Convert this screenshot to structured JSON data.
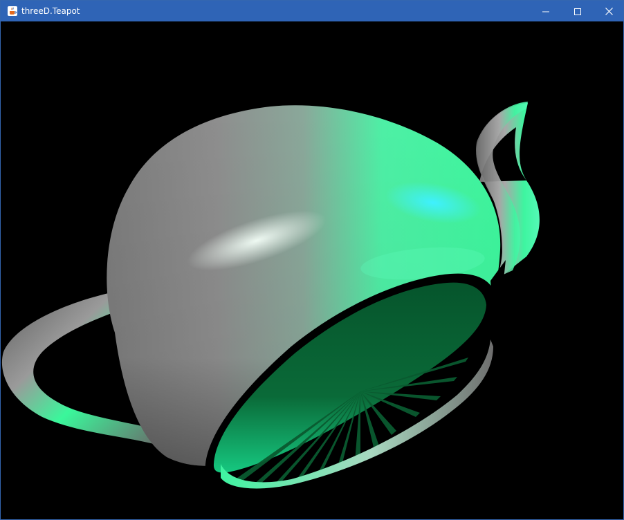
{
  "window": {
    "title": "threeD.Teapot",
    "controls": {
      "minimize_icon": "minimize-icon",
      "maximize_icon": "maximize-icon",
      "close_icon": "close-icon"
    },
    "app_icon": "java-cup-icon"
  },
  "colors": {
    "titlebar": "#2f64b6",
    "canvas_background": "#000000",
    "teapot_gray": "#8c8c8c",
    "teapot_green": "#3ff5a0",
    "teapot_dark_green": "#06552c",
    "highlight_cyan": "#3ff0ff"
  },
  "scene": {
    "object": "teapot",
    "render_style": "3D shaded"
  }
}
